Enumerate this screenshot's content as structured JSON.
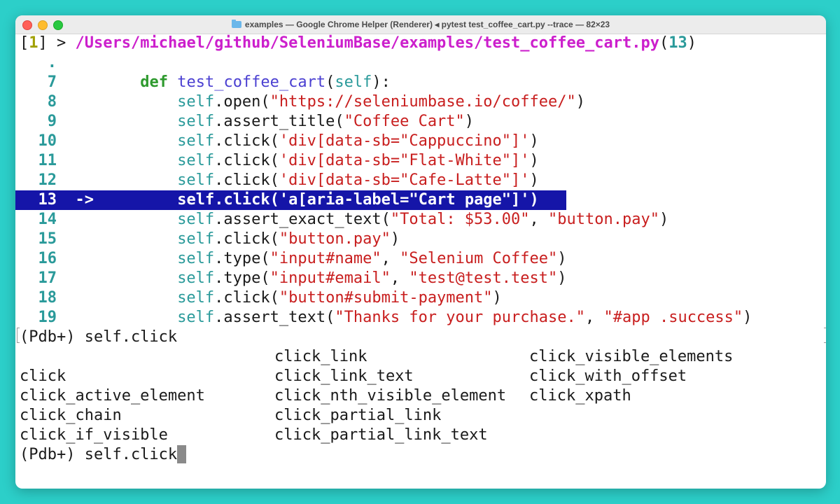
{
  "window": {
    "title": "examples — Google Chrome Helper (Renderer) ◂ pytest test_coffee_cart.py --trace — 82×23"
  },
  "header": {
    "frame": "1",
    "prompt": ">",
    "path": "/Users/michael/github/SeleniumBase/examples/test_coffee_cart.py",
    "line": "13"
  },
  "code": {
    "dot": ".",
    "lines": [
      {
        "num": "7",
        "arrow": "",
        "kw": "def",
        "fn": "test_coffee_cart",
        "rest": "(self):"
      },
      {
        "num": "8",
        "method": ".open(",
        "args": "\"https://seleniumbase.io/coffee/\"",
        "tail": ")"
      },
      {
        "num": "9",
        "method": ".assert_title(",
        "args": "\"Coffee Cart\"",
        "tail": ")"
      },
      {
        "num": "10",
        "method": ".click(",
        "args": "'div[data-sb=\"Cappuccino\"]'",
        "tail": ")"
      },
      {
        "num": "11",
        "method": ".click(",
        "args": "'div[data-sb=\"Flat-White\"]'",
        "tail": ")"
      },
      {
        "num": "12",
        "method": ".click(",
        "args": "'div[data-sb=\"Cafe-Latte\"]'",
        "tail": ")"
      },
      {
        "num": "13",
        "arrow": "->",
        "text": "self.click('a[aria-label=\"Cart page\"]')"
      },
      {
        "num": "14",
        "method": ".assert_exact_text(",
        "args": "\"Total: $53.00\"",
        "sep": ", ",
        "args2": "\"button.pay\"",
        "tail": ")"
      },
      {
        "num": "15",
        "method": ".click(",
        "args": "\"button.pay\"",
        "tail": ")"
      },
      {
        "num": "16",
        "method": ".type(",
        "args": "\"input#name\"",
        "sep": ", ",
        "args2": "\"Selenium Coffee\"",
        "tail": ")"
      },
      {
        "num": "17",
        "method": ".type(",
        "args": "\"input#email\"",
        "sep": ", ",
        "args2": "\"test@test.test\"",
        "tail": ")"
      },
      {
        "num": "18",
        "method": ".click(",
        "args": "\"button#submit-payment\"",
        "tail": ")"
      },
      {
        "num": "19",
        "method": ".assert_text(",
        "args": "\"Thanks for your purchase.\"",
        "sep": ", ",
        "args2": "\"#app .success\"",
        "tail": ")"
      }
    ],
    "self_word": "self"
  },
  "pdb": {
    "prompt1": "(Pdb+) self.click",
    "completions": {
      "col1": [
        "",
        "click",
        "click_active_element",
        "click_chain",
        "click_if_visible"
      ],
      "col2": [
        "click_link",
        "click_link_text",
        "click_nth_visible_element",
        "click_partial_link",
        "click_partial_link_text"
      ],
      "col3": [
        "click_visible_elements",
        "click_with_offset",
        "click_xpath",
        "",
        ""
      ]
    },
    "prompt2": "(Pdb+) self.click"
  },
  "colors": {
    "background": "#2ccfc9",
    "highlight": "#1515a8",
    "string": "#c81e1e",
    "keyword": "#2e9a2e",
    "path": "#cc1fcc"
  }
}
